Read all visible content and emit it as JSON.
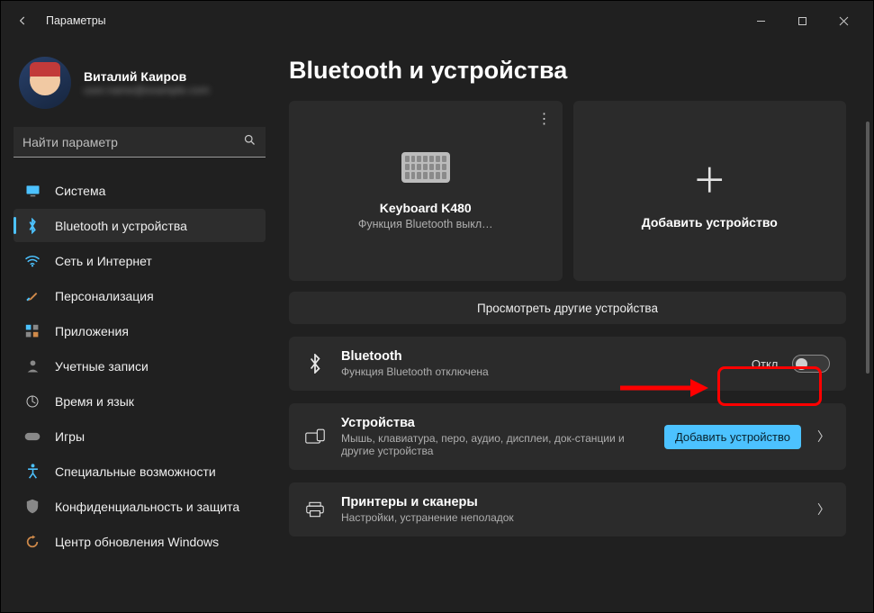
{
  "titlebar": {
    "app": "Параметры"
  },
  "profile": {
    "name": "Виталий Каиров",
    "email": "user.name@example.com"
  },
  "search": {
    "placeholder": "Найти параметр"
  },
  "nav": [
    {
      "label": "Система",
      "icon": "monitor"
    },
    {
      "label": "Bluetooth и устройства",
      "icon": "bluetooth",
      "active": true
    },
    {
      "label": "Сеть и Интернет",
      "icon": "wifi"
    },
    {
      "label": "Персонализация",
      "icon": "brush"
    },
    {
      "label": "Приложения",
      "icon": "apps"
    },
    {
      "label": "Учетные записи",
      "icon": "user"
    },
    {
      "label": "Время и язык",
      "icon": "globe"
    },
    {
      "label": "Игры",
      "icon": "game"
    },
    {
      "label": "Специальные возможности",
      "icon": "access"
    },
    {
      "label": "Конфиденциальность и защита",
      "icon": "shield"
    },
    {
      "label": "Центр обновления Windows",
      "icon": "update"
    }
  ],
  "page": {
    "title": "Bluetooth и устройства"
  },
  "devices": {
    "card1": {
      "name": "Keyboard K480",
      "sub": "Функция Bluetooth выкл…"
    },
    "add": {
      "label": "Добавить устройство"
    }
  },
  "view_more": "Просмотреть другие устройства",
  "rows": {
    "bluetooth": {
      "title": "Bluetooth",
      "sub": "Функция Bluetooth отключена",
      "toggle_label": "Откл."
    },
    "devices": {
      "title": "Устройства",
      "sub": "Мышь, клавиатура, перо, аудио, дисплеи, док-станции и другие устройства",
      "button": "Добавить устройство"
    },
    "printers": {
      "title": "Принтеры и сканеры",
      "sub": "Настройки, устранение неполадок"
    }
  }
}
